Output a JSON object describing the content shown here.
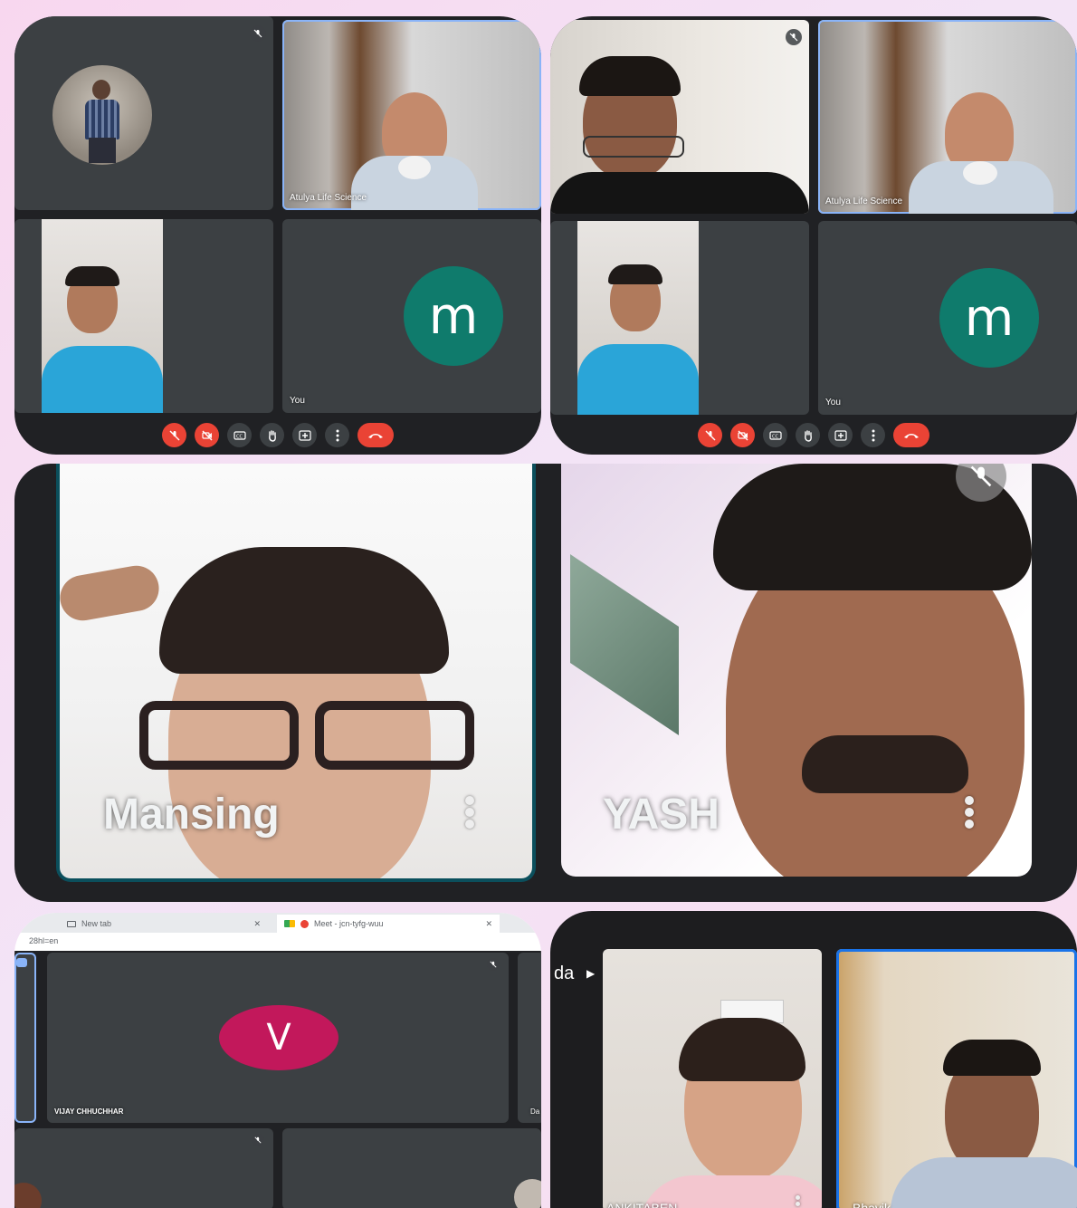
{
  "panel1": {
    "tiles": {
      "top_right_name": "Atulya Life Science",
      "bottom_right_name": "You",
      "avatar_letter": "m"
    },
    "controls": [
      "mic-off",
      "camera-off",
      "captions",
      "raise-hand",
      "present",
      "more",
      "end-call"
    ]
  },
  "panel2": {
    "tiles": {
      "top_right_name": "Atulya Life Science",
      "bottom_right_name": "You",
      "avatar_letter": "m"
    }
  },
  "panel3": {
    "left_name": "Mansing",
    "right_name": "YASH"
  },
  "panel4": {
    "tabs": [
      "New tab",
      "Meet - jcn-tyfg-wuu"
    ],
    "url": "28hl=en",
    "avatar_letter": "V",
    "tile_name": "VIJAY CHHUCHHAR",
    "edge_name": "Da"
  },
  "panel5": {
    "edge_label": "da",
    "left_name": "ANKITABEN",
    "right_name": "Bhavik"
  },
  "colors": {
    "panel_bg": "#202124",
    "tile_bg": "#3c4043",
    "avatar_m": "#0f7b6c",
    "avatar_v": "#c2185b",
    "end_call": "#ea4335",
    "active_border": "#8ab4f8"
  }
}
